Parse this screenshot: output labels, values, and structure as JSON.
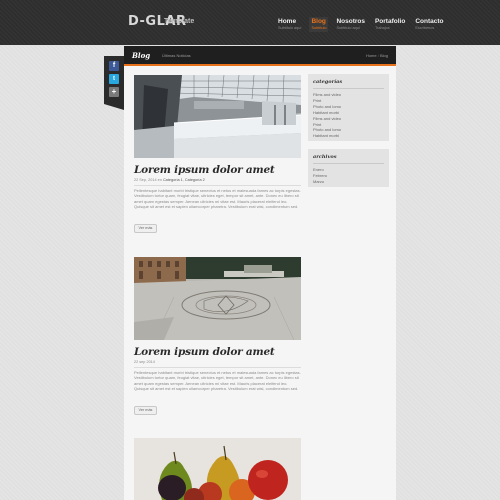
{
  "header": {
    "logo": "D-GLAR",
    "logo_sub": "Template",
    "nav": [
      {
        "label": "Home",
        "sub": "Subtítulo aquí"
      },
      {
        "label": "Blog",
        "sub": "Subtítulo"
      },
      {
        "label": "Nosotros",
        "sub": "Subtítulo aquí"
      },
      {
        "label": "Portafolio",
        "sub": "Trabajos"
      },
      {
        "label": "Contacto",
        "sub": "Escríbenos"
      }
    ],
    "active_nav_index": 1
  },
  "titlebar": {
    "title": "Blog",
    "subtitle": "Últimas Noticias",
    "crumb_home": "Home",
    "crumb_sep": "/",
    "crumb_current": "Blog"
  },
  "social": [
    {
      "icon": "facebook-icon",
      "glyph": "f"
    },
    {
      "icon": "twitter-icon",
      "glyph": "t"
    },
    {
      "icon": "plus-icon",
      "glyph": "+"
    }
  ],
  "posts": [
    {
      "image": "building-interior-photo",
      "title": "Lorem ipsum dolor amet",
      "date": "22 Sep, 2014 en",
      "cat1": "Categoría 1",
      "cat_sep": ",",
      "cat2": "Categoría 2",
      "body": "Pellentesque habitant morbi tristique senectus et netus et malesuada fames ac turpis egestas. Vestibulum tortor quam, feugiat vitae, ultricies eget, tempor sit amet, ante. Donec eu libero sit amet quam egestas semper. Aenean ultricies mi vitae est. Mauris placerat eleifend leo. Quisque sit amet est et sapien ullamcorper pharetra. Vestibulum erat wisi, condimentum sed.",
      "more": "Ver más"
    },
    {
      "image": "plaza-photo",
      "title": "Lorem ipsum dolor amet",
      "date": "22 sep 2014",
      "body": "Pellentesque habitant morbi tristique senectus et netus et malesuada fames ac turpis egestas. Vestibulum tortor quam, feugiat vitae, ultricies eget, tempor sit amet, ante. Donec eu libero sit amet quam egestas semper. Aenean ultricies mi vitae est. Mauris placerat eleifend leo. Quisque sit amet est et sapien ullamcorper pharetra. Vestibulum erat wisi, condimentum sed.",
      "more": "Ver más"
    },
    {
      "image": "fruit-photo"
    }
  ],
  "sidebar": {
    "categories": {
      "title": "categorías",
      "items": [
        "Films and video",
        "Print",
        "Photo and lomo",
        "Habitant morbi",
        "Films and video",
        "Print",
        "Photo and lomo",
        "Habitant morbi"
      ]
    },
    "archives": {
      "title": "archivos",
      "items": [
        "Enero",
        "Febrero",
        "Marzo"
      ]
    }
  },
  "colors": {
    "accent": "#e8721c",
    "header": "#2e2e2e",
    "titlebar": "#1f1f1f",
    "background": "#e4e4e4",
    "content": "#f5f5f5",
    "widget": "#e3e3e3"
  }
}
